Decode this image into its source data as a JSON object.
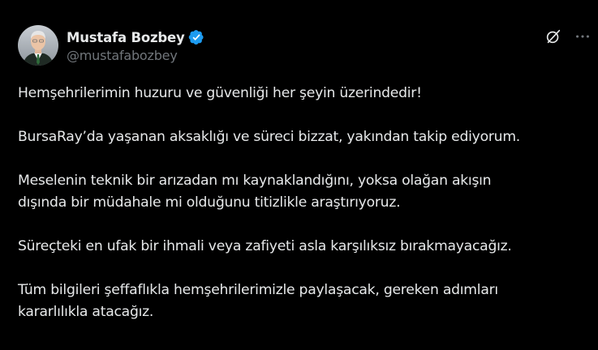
{
  "author": {
    "display_name": "Mustafa Bozbey",
    "handle": "@mustafabozbey",
    "verified": true,
    "verified_color": "#1d9bf0"
  },
  "header_actions": {
    "grok_icon": "grok-icon",
    "more_icon": "more-horizontal-icon"
  },
  "post": {
    "paragraphs": [
      "Hemşehrilerimin huzuru ve güvenliği her şeyin üzerindedir!",
      "BursaRay’da yaşanan aksaklığı ve süreci bizzat, yakından takip ediyorum.",
      "Meselenin teknik bir arızadan mı kaynaklandığını, yoksa olağan akışın\ndışında bir müdahale mi olduğunu titizlikle araştırıyoruz.",
      "Süreçteki en ufak bir ihmali veya zafiyeti asla karşılıksız bırakmayacağız.",
      "Tüm bilgileri şeffaflıkla hemşehrilerimizle paylaşacak, gereken adımları\nkararlılıkla atacağız."
    ]
  },
  "theme": {
    "background": "#000000",
    "text_primary": "#e7e9ea",
    "text_secondary": "#71767b"
  }
}
